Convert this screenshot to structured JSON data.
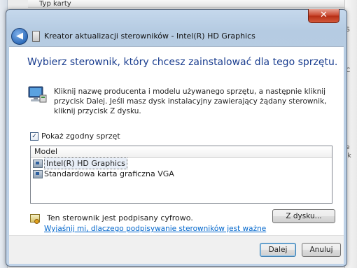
{
  "background": {
    "window_title_fragment": "Typ karty",
    "right_fragments": [
      "S",
      "C",
      "e",
      "lk"
    ]
  },
  "dialog": {
    "title": "Kreator aktualizacji sterowników - Intel(R) HD Graphics",
    "close_label": "✕",
    "heading": "Wybierz sterownik, który chcesz zainstalować dla tego sprzętu.",
    "instructions": "Kliknij nazwę producenta i modelu używanego sprzętu, a następnie kliknij przycisk Dalej. Jeśli masz dysk instalacyjny zawierający żądany sterownik, kliknij przycisk Z dysku.",
    "show_compatible_label": "Pokaż zgodny sprzęt",
    "show_compatible_checked": true,
    "model_column": "Model",
    "models": [
      {
        "label": "Intel(R) HD Graphics",
        "selected": true
      },
      {
        "label": "Standardowa karta graficzna VGA",
        "selected": false
      }
    ],
    "signed_text": "Ten sterownik jest podpisany cyfrowo.",
    "why_link": "Wyjaśnij mi, dlaczego podpisywanie sterowników jest ważne",
    "have_disk_button": "Z dysku...",
    "next_button": "Dalej",
    "cancel_button": "Anuluj"
  },
  "colors": {
    "heading": "#1a3d8f",
    "link": "#0066cc",
    "close_button": "#c8432a"
  }
}
